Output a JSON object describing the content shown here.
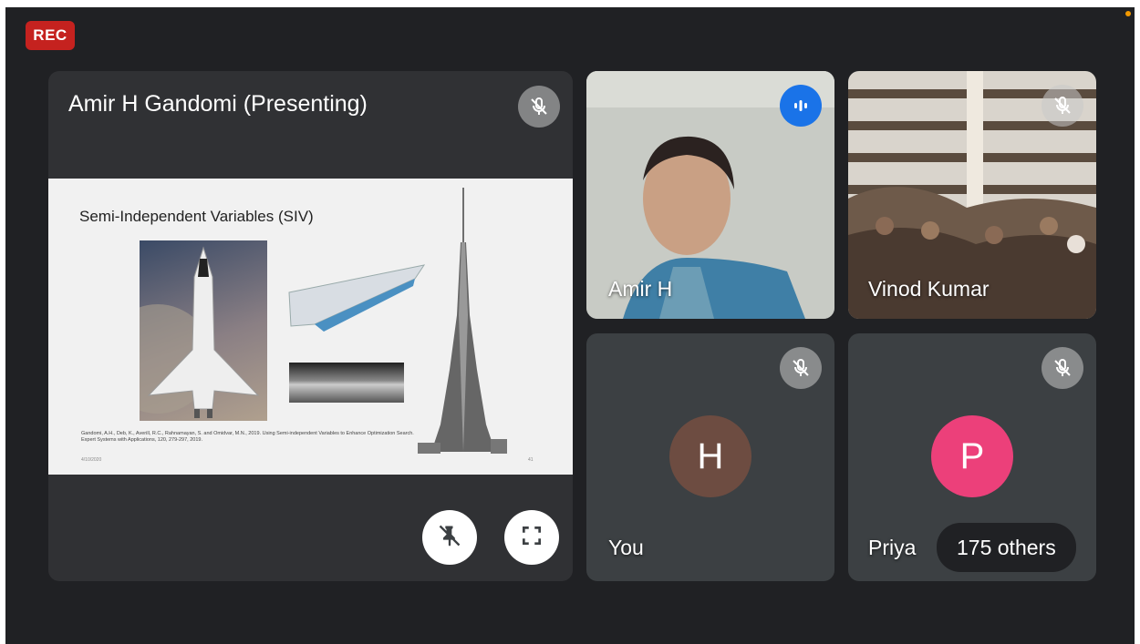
{
  "recording": {
    "label": "REC"
  },
  "presenter_tile": {
    "title": "Amir H Gandomi (Presenting)",
    "slide": {
      "title": "Semi-Independent Variables (SIV)",
      "reference": "Gandomi, A.H., Deb, K., Averill, R.C., Rahnamayan, S. and Omidvar, M.N., 2019. Using Semi-independent Variables to Enhance Optimization Search. Expert Systems with Applications, 120, 279-297, 2019.",
      "footer_left": "4/10/2020",
      "footer_right": "41"
    },
    "controls": {
      "unpin_icon": "pin-off-icon",
      "fullscreen_icon": "fullscreen-icon"
    }
  },
  "participants": [
    {
      "name": "Amir H",
      "status": "speaking",
      "icon": "audio-wave-icon"
    },
    {
      "name": "Vinod Kumar",
      "status": "muted",
      "icon": "mic-off-icon"
    },
    {
      "name": "You",
      "status": "muted",
      "avatar_letter": "H",
      "avatar_color": "#6d4c41"
    },
    {
      "name": "Priya",
      "status": "muted",
      "avatar_letter": "P",
      "avatar_color": "#ec407a",
      "others_label": "175 others"
    }
  ],
  "colors": {
    "background": "#202124",
    "tile": "#3c4043",
    "rec": "#c5221f",
    "speaking": "#1a73e8"
  }
}
